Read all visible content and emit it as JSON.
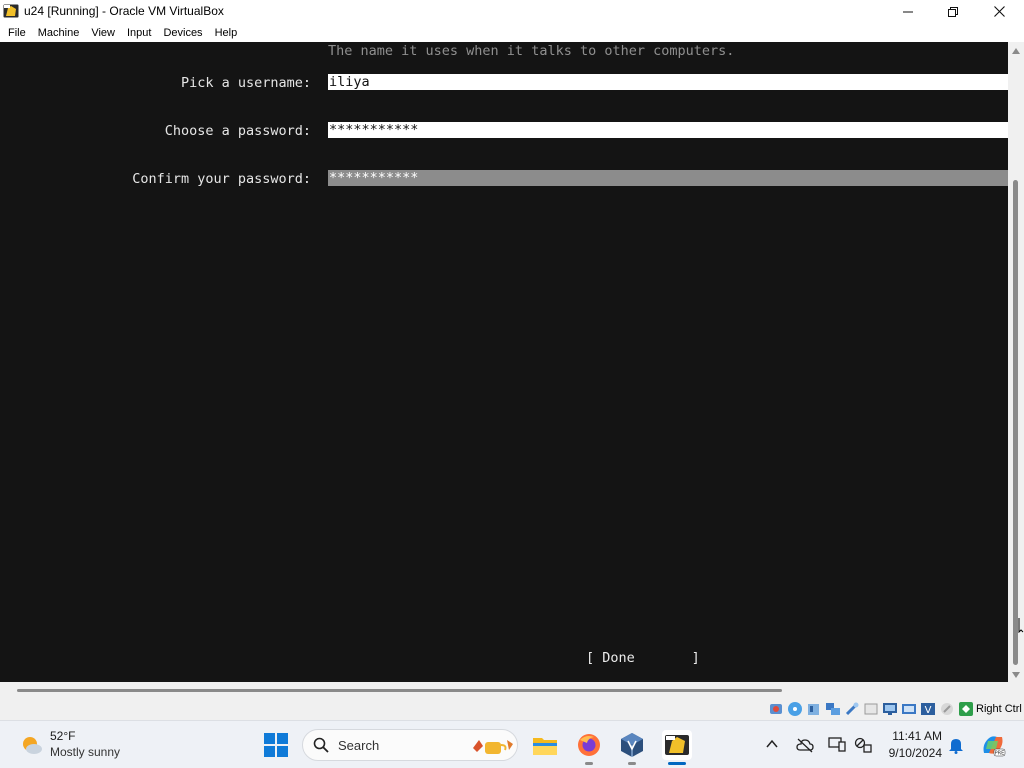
{
  "window": {
    "title": "u24 [Running] - Oracle VM VirtualBox",
    "minimize_glyph": "—",
    "maximize_glyph": "□",
    "close_glyph": "✕"
  },
  "menu": {
    "items": [
      "File",
      "Machine",
      "View",
      "Input",
      "Devices",
      "Help"
    ]
  },
  "installer": {
    "hostname_hint": "The name it uses when it talks to other computers.",
    "username_label": "Pick a username:",
    "username_value": "iliya",
    "password_label": "Choose a password:",
    "password_value": "***********",
    "confirm_label": "Confirm your password:",
    "confirm_value": "***********",
    "done_button": "[ Done       ]"
  },
  "status_bar": {
    "host_key": "Right Ctrl",
    "icons": [
      "hard-disk-icon",
      "optical-drive-icon",
      "audio-icon",
      "network-icon",
      "usb-icon",
      "shared-folders-icon",
      "display-icon",
      "recording-icon",
      "cpu-icon",
      "mouse-integration-icon",
      "keyboard-icon"
    ]
  },
  "taskbar": {
    "weather_temp": "52°F",
    "weather_desc": "Mostly sunny",
    "search_placeholder": "Search",
    "clock_time": "11:41 AM",
    "clock_date": "9/10/2024",
    "pinned_apps": [
      "file-explorer",
      "firefox",
      "virtualbox-manager",
      "virtualbox-vm"
    ]
  },
  "colors": {
    "vm_background": "#141414",
    "focused_field": "#8c8c8c",
    "accent": "#0067c0"
  }
}
